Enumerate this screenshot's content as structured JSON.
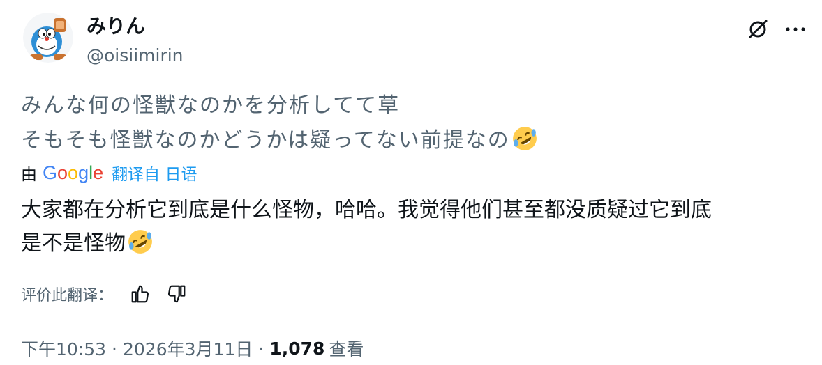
{
  "tweet": {
    "display_name": "みりん",
    "handle": "@oisiimirin",
    "original_lines": [
      "みんな何の怪獣なのかを分析してて草",
      "そもそも怪獣なのかどうかは疑ってない前提なの"
    ],
    "emoji_icon": "rolling-on-the-floor-laughing-emoji",
    "translated_by_prefix": "由",
    "google": [
      "G",
      "o",
      "o",
      "g",
      "l",
      "e"
    ],
    "translated_from": "翻译自 日语",
    "translated_lines": [
      "大家都在分析它到底是什么怪物，哈哈。我觉得他们甚至都没质疑过它到底",
      "是不是怪物"
    ],
    "rate_label": "评价此翻译：",
    "time": "下午10:53",
    "separator": "·",
    "date": "2026年3月11日",
    "views_count": "1,078",
    "views_label": "查看"
  },
  "colors": {
    "text": "#0f1419",
    "secondary": "#536471",
    "link": "#1d9bf0"
  },
  "icons": [
    "grok-icon",
    "more-icon",
    "thumbs-up-icon",
    "thumbs-down-icon",
    "avatar-image"
  ]
}
